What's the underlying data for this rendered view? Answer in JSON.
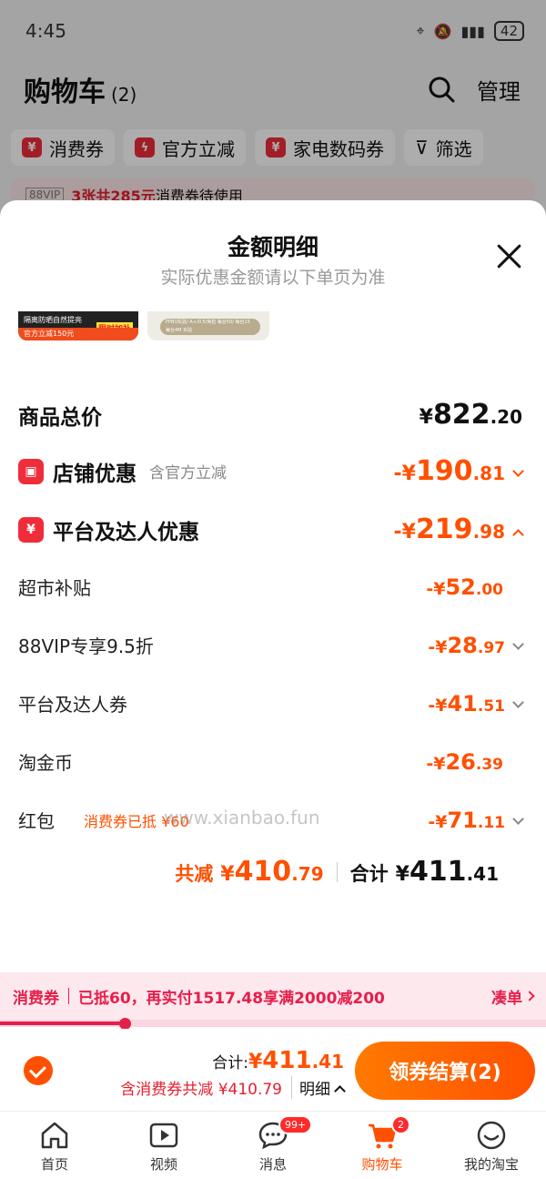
{
  "status_bar": {
    "time": "4:45",
    "battery": "42"
  },
  "header": {
    "title": "购物车",
    "count": "(2)",
    "manage_label": "管理"
  },
  "filters": [
    {
      "label": "消费券",
      "icon": "coupon-icon"
    },
    {
      "label": "官方立减",
      "icon": "flash-icon"
    },
    {
      "label": "家电数码券",
      "icon": "coupon-icon"
    }
  ],
  "filter_button": {
    "label": "筛选"
  },
  "vip_bar": {
    "tag": "88VIP",
    "highlight": "3张共285元",
    "text": "消费券待使用"
  },
  "sheet": {
    "title": "金额明细",
    "subtitle": "实际优惠金额请以下单页为准",
    "thumb1": {
      "top_text": "隔离防晒自然提亮",
      "bottom_text": "官方立减150元",
      "tag": "限时加补"
    },
    "thumb2": {
      "pill_text": "PPBU实验/ A+/0.5/免检 每台50/ 每台15 每台4M 实验"
    },
    "goods_total": {
      "label": "商品总价",
      "sym": "¥",
      "int": "822",
      "dec": ".20"
    },
    "store_discount": {
      "label": "店铺优惠",
      "note": "含官方立减",
      "sym": "-¥",
      "int": "190",
      "dec": ".81"
    },
    "platform_discount": {
      "label": "平台及达人优惠",
      "sym": "-¥",
      "int": "219",
      "dec": ".98"
    },
    "items": [
      {
        "label": "超市补贴",
        "sym": "-¥",
        "int": "52",
        "dec": ".00"
      },
      {
        "label": "88VIP专享9.5折",
        "sym": "-¥",
        "int": "28",
        "dec": ".97"
      },
      {
        "label": "平台及达人券",
        "sym": "-¥",
        "int": "41",
        "dec": ".51"
      },
      {
        "label": "淘金币",
        "sym": "-¥",
        "int": "26",
        "dec": ".39"
      },
      {
        "label": "红包",
        "note": "消费券已抵 ¥60",
        "sym": "-¥",
        "int": "71",
        "dec": ".11"
      }
    ],
    "watermark": "www.xianbao.fun",
    "total_reduce": {
      "label": "共减",
      "sym": "¥",
      "int": "410",
      "dec": ".79"
    },
    "total": {
      "label": "合计",
      "sym": "¥",
      "int": "411",
      "dec": ".41"
    }
  },
  "coupon_bar": {
    "label": "消费券",
    "text": "已抵60，再实付1517.48享满2000减200",
    "action": "凑单",
    "progress": 0.23
  },
  "checkout": {
    "total_label": "合计:",
    "sym": "¥",
    "int": "411",
    "dec": ".41",
    "sub_text": "含消费券共减 ¥410.79",
    "detail_label": "明细",
    "button": "领券结算(2)"
  },
  "tabbar": [
    {
      "label": "首页",
      "icon": "home-icon"
    },
    {
      "label": "视频",
      "icon": "video-icon"
    },
    {
      "label": "消息",
      "icon": "message-icon",
      "badge": "99+"
    },
    {
      "label": "购物车",
      "icon": "cart-icon",
      "badge": "2",
      "active": true
    },
    {
      "label": "我的淘宝",
      "icon": "profile-icon"
    }
  ],
  "colors": {
    "accent": "#ff5000",
    "red": "#e61e2d",
    "coupon_pink": "#e61e4a"
  }
}
